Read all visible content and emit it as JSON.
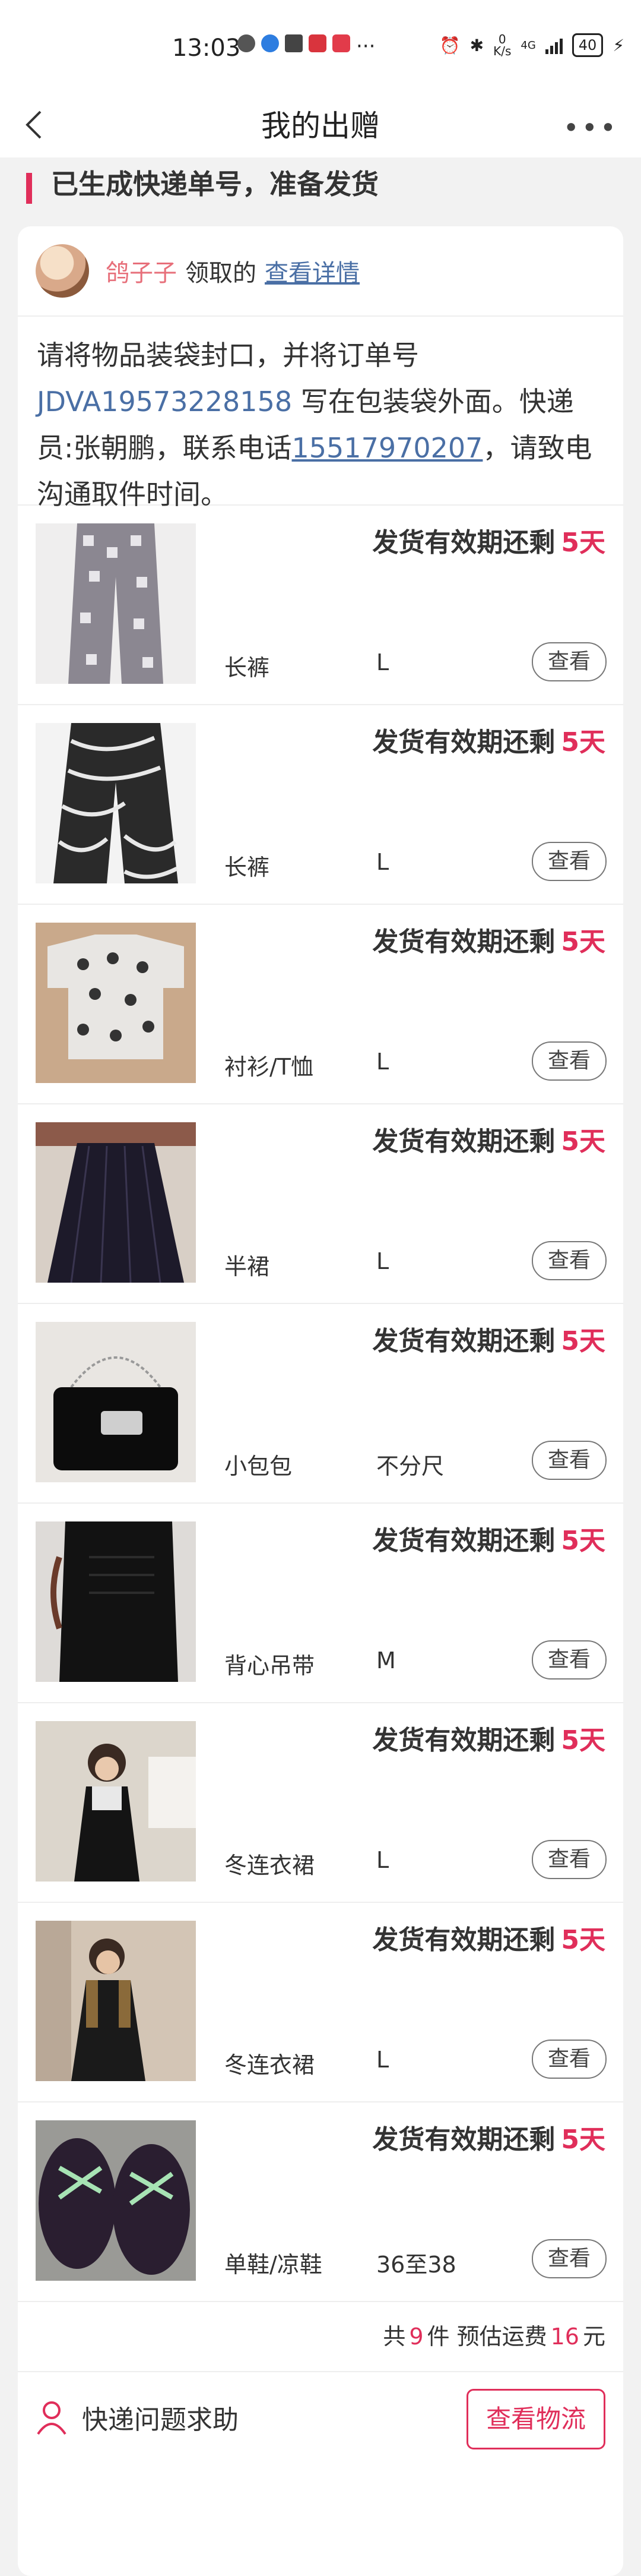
{
  "status_bar": {
    "time": "13:03",
    "network_speed": "0\nK/s",
    "network_type": "4G",
    "battery": "40"
  },
  "nav": {
    "title": "我的出赠"
  },
  "status_heading": "已生成快递单号，准备发货",
  "receiver": {
    "name": "鸽子子",
    "verb": "领取的",
    "detail_link": "查看详情"
  },
  "notice": {
    "part1": "请将物品装袋封口，并将订单号 ",
    "order_no": "JDVA19573228158",
    "part2": " 写在包装袋外面。快递员:张朝鹏，联系电话",
    "phone": "15517970207",
    "part3": "，请致电沟通取件时间。"
  },
  "deadline_label": "发货有效期还剩",
  "items": [
    {
      "category": "长裤",
      "size": "L",
      "days": "5天",
      "view": "查看"
    },
    {
      "category": "长裤",
      "size": "L",
      "days": "5天",
      "view": "查看"
    },
    {
      "category": "衬衫/T恤",
      "size": "L",
      "days": "5天",
      "view": "查看"
    },
    {
      "category": "半裙",
      "size": "L",
      "days": "5天",
      "view": "查看"
    },
    {
      "category": "小包包",
      "size": "不分尺",
      "days": "5天",
      "view": "查看"
    },
    {
      "category": "背心吊带",
      "size": "M",
      "days": "5天",
      "view": "查看"
    },
    {
      "category": "冬连衣裙",
      "size": "L",
      "days": "5天",
      "view": "查看"
    },
    {
      "category": "冬连衣裙",
      "size": "L",
      "days": "5天",
      "view": "查看"
    },
    {
      "category": "单鞋/凉鞋",
      "size": "36至38",
      "days": "5天",
      "view": "查看"
    }
  ],
  "summary": {
    "prefix": "共",
    "count": "9",
    "count_unit": "件 预估运费",
    "fee": "16",
    "fee_unit": "元"
  },
  "footer": {
    "help": "快递问题求助",
    "track_button": "查看物流"
  },
  "colors": {
    "accent": "#e02e5a",
    "link": "#4a6fa5"
  }
}
